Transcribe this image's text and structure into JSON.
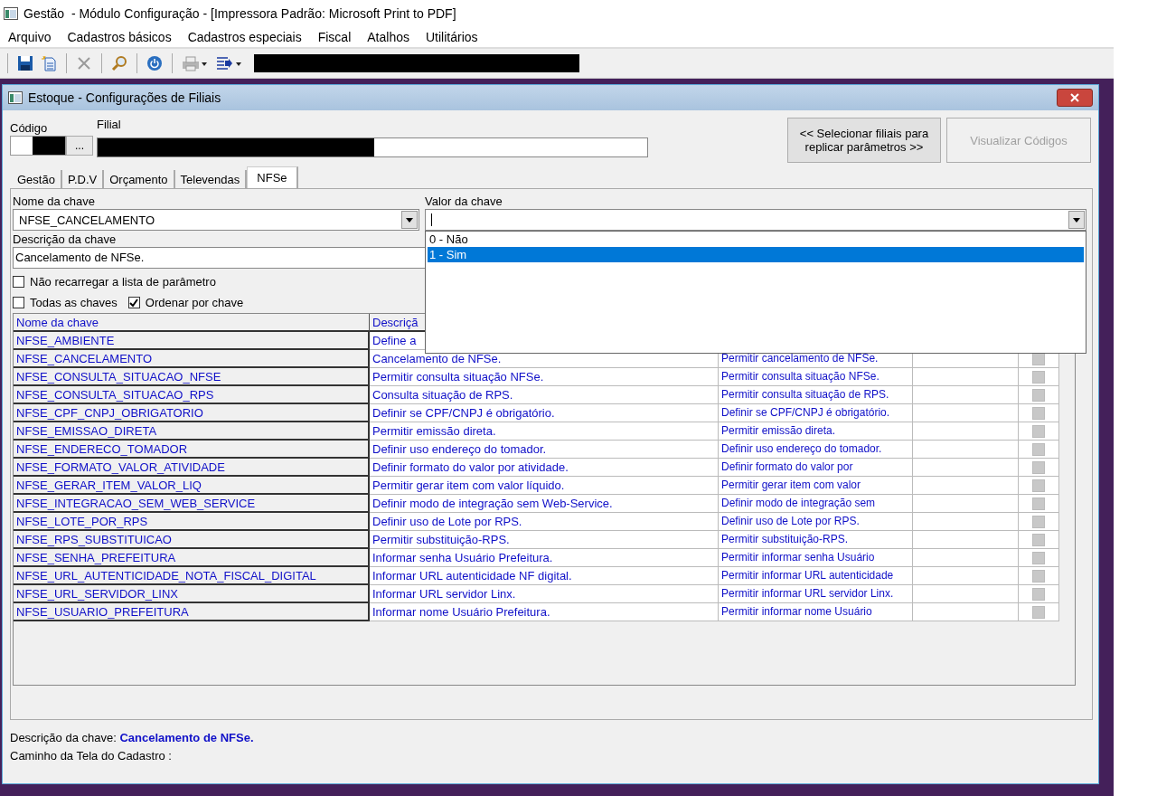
{
  "window": {
    "title": "Gestão  - Módulo Configuração - [Impressora Padrão: Microsoft Print to PDF]"
  },
  "menu": [
    "Arquivo",
    "Cadastros básicos",
    "Cadastros especiais",
    "Fiscal",
    "Atalhos",
    "Utilitários"
  ],
  "toolbar": [
    {
      "kind": "save",
      "disabled": false
    },
    {
      "kind": "new",
      "disabled": false
    },
    {
      "kind": "delete",
      "disabled": true
    },
    {
      "kind": "search",
      "disabled": false
    },
    {
      "kind": "power",
      "disabled": false
    },
    {
      "kind": "print",
      "disabled": true
    },
    {
      "kind": "export",
      "disabled": false
    }
  ],
  "child_window": {
    "title": "Estoque - Configurações de Filiais"
  },
  "codigo": {
    "label": "Código",
    "browse": "..."
  },
  "filial": {
    "label": "Filial"
  },
  "buttons": [
    {
      "label": "<< Selecionar filiais para replicar parâmetros >>",
      "disabled": false
    },
    {
      "label": "Visualizar Códigos",
      "disabled": true
    }
  ],
  "tabs": [
    {
      "label": "Gestão",
      "selected": false
    },
    {
      "label": "P.D.V",
      "selected": false
    },
    {
      "label": "Orçamento",
      "selected": false
    },
    {
      "label": "Televendas",
      "selected": false
    },
    {
      "label": "NFSe",
      "selected": true
    }
  ],
  "key_name": {
    "label": "Nome da chave",
    "value": "NFSE_CANCELAMENTO"
  },
  "key_value": {
    "label": "Valor da chave",
    "options": [
      {
        "label": "0 - Não",
        "selected": false
      },
      {
        "label": "1 - Sim",
        "selected": true
      }
    ]
  },
  "key_description": {
    "label": "Descrição da chave",
    "value": "Cancelamento de NFSe."
  },
  "checkboxes": [
    {
      "label": "Não recarregar a lista de parâmetro",
      "checked": false
    },
    {
      "label": "Todas as chaves",
      "checked": false
    },
    {
      "label": "Ordenar por chave",
      "checked": true
    }
  ],
  "table": {
    "columns": [
      "Nome da chave",
      "Descriçã"
    ],
    "rows": [
      {
        "name": "NFSE_AMBIENTE",
        "description": "Define a"
      },
      {
        "name": "NFSE_CANCELAMENTO",
        "description": "Cancelamento de NFSe.",
        "column_3": "Permitir cancelamento de NFSe.",
        "checked": false
      },
      {
        "name": "NFSE_CONSULTA_SITUACAO_NFSE",
        "description": "Permitir consulta situação NFSe.",
        "column_3": "Permitir consulta situação NFSe.",
        "checked": false
      },
      {
        "name": "NFSE_CONSULTA_SITUACAO_RPS",
        "description": "Consulta situação de RPS.",
        "column_3": "Permitir consulta situação de RPS.",
        "checked": false
      },
      {
        "name": "NFSE_CPF_CNPJ_OBRIGATORIO",
        "description": "Definir se CPF/CNPJ é obrigatório.",
        "column_3": "Definir se CPF/CNPJ é obrigatório.",
        "checked": false
      },
      {
        "name": "NFSE_EMISSAO_DIRETA",
        "description": "Permitir emissão direta.",
        "column_3": "Permitir emissão direta.",
        "checked": false
      },
      {
        "name": "NFSE_ENDERECO_TOMADOR",
        "description": "Definir uso endereço do tomador.",
        "column_3": "Definir uso endereço do tomador.",
        "checked": false
      },
      {
        "name": "NFSE_FORMATO_VALOR_ATIVIDADE",
        "description": "Definir formato do valor por atividade.",
        "column_3": "Definir formato do valor por",
        "checked": false
      },
      {
        "name": "NFSE_GERAR_ITEM_VALOR_LIQ",
        "description": "Permitir gerar item com valor líquido.",
        "column_3": "Permitir gerar item com valor",
        "checked": false
      },
      {
        "name": "NFSE_INTEGRACAO_SEM_WEB_SERVICE",
        "description": "Definir modo de integração sem Web-Service.",
        "column_3": "Definir modo de integração sem",
        "checked": false
      },
      {
        "name": "NFSE_LOTE_POR_RPS",
        "description": "Definir uso de Lote por RPS.",
        "column_3": "Definir uso de Lote por RPS.",
        "checked": false
      },
      {
        "name": "NFSE_RPS_SUBSTITUICAO",
        "description": "Permitir substituição-RPS.",
        "column_3": "Permitir substituição-RPS.",
        "checked": false
      },
      {
        "name": "NFSE_SENHA_PREFEITURA",
        "description": "Informar senha Usuário Prefeitura.",
        "column_3": "Permitir informar senha Usuário",
        "checked": false
      },
      {
        "name": "NFSE_URL_AUTENTICIDADE_NOTA_FISCAL_DIGITAL",
        "description": "Informar URL autenticidade NF digital.",
        "column_3": "Permitir informar URL autenticidade",
        "checked": false
      },
      {
        "name": "NFSE_URL_SERVIDOR_LINX",
        "description": "Informar URL servidor Linx.",
        "column_3": "Permitir informar URL servidor Linx.",
        "checked": false
      },
      {
        "name": "NFSE_USUARIO_PREFEITURA",
        "description": "Informar nome Usuário Prefeitura.",
        "column_3": "Permitir informar nome Usuário",
        "checked": false
      }
    ]
  },
  "footer": {
    "description_label": "Descrição da chave:",
    "description_value": "Cancelamento de NFSe.",
    "path_label": "Caminho da Tela do Cadastro :"
  }
}
